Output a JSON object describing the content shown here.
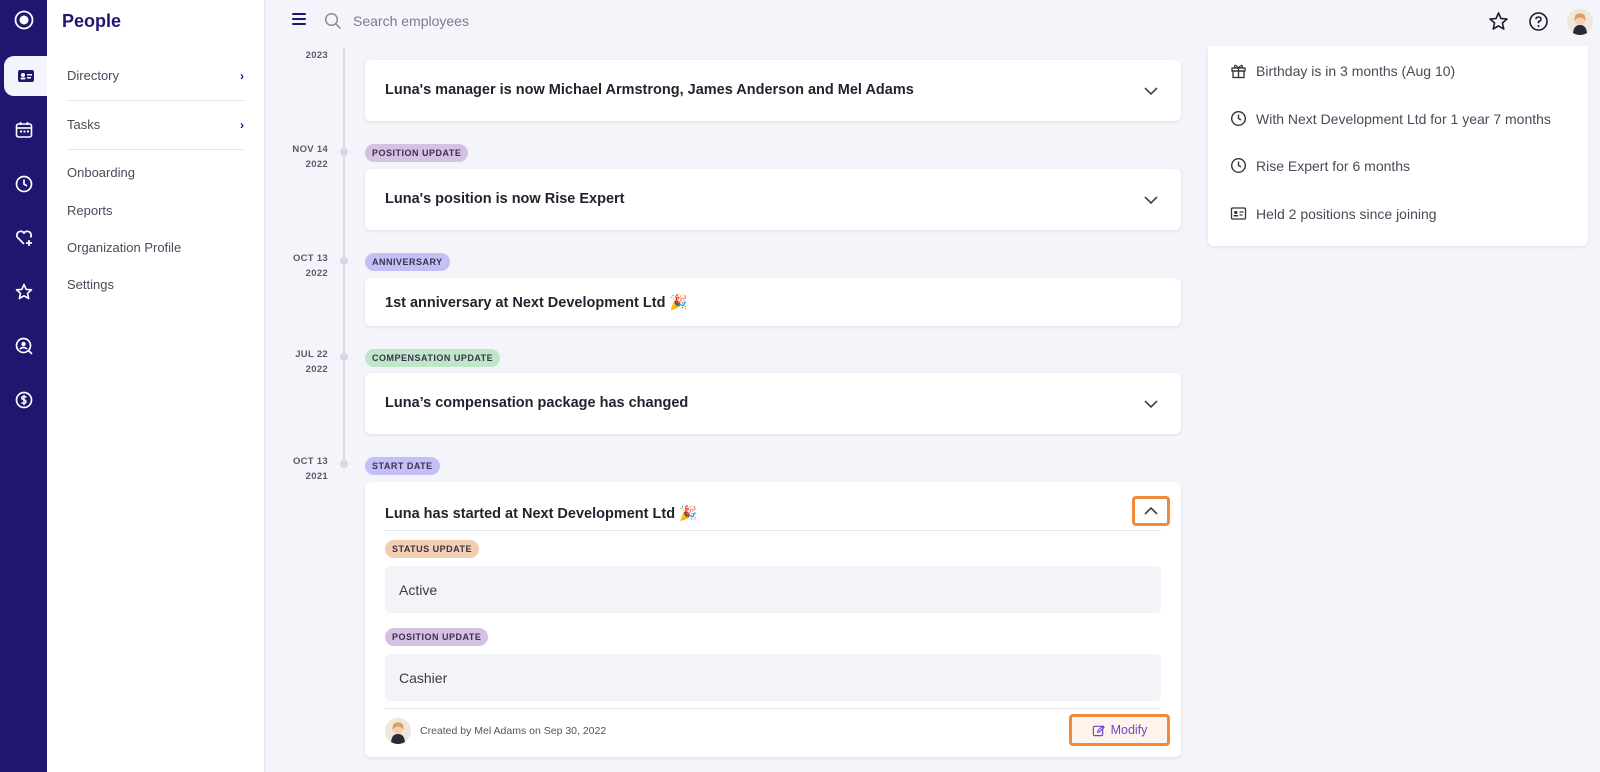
{
  "app": {
    "section_title": "People"
  },
  "sidenav": {
    "items": [
      {
        "label": "Directory",
        "has_submenu": true
      },
      {
        "label": "Tasks",
        "has_submenu": true
      },
      {
        "label": "Onboarding"
      },
      {
        "label": "Reports"
      },
      {
        "label": "Organization Profile"
      },
      {
        "label": "Settings"
      }
    ]
  },
  "rail": {
    "icons": [
      "logo-icon",
      "people-card-icon",
      "calendar-icon",
      "clock-icon",
      "heart-plus-icon",
      "star-person-icon",
      "search-person-icon",
      "dollar-icon"
    ],
    "active": "people-card-icon"
  },
  "search": {
    "placeholder": "Search employees"
  },
  "timeline": {
    "top_partial_date": "2023",
    "top_card_title": "Luna's manager is now Michael Armstrong, James Anderson and Mel Adams",
    "events": [
      {
        "date_month_day": "NOV 14",
        "date_year": "2022",
        "tag": "POSITION UPDATE",
        "title": "Luna's position is now Rise Expert"
      },
      {
        "date_month_day": "OCT 13",
        "date_year": "2022",
        "tag": "ANNIVERSARY",
        "title": "1st anniversary at Next Development Ltd",
        "emoji": "🎉"
      },
      {
        "date_month_day": "JUL 22",
        "date_year": "2022",
        "tag": "COMPENSATION UPDATE",
        "title": "Luna’s compensation package has changed"
      },
      {
        "date_month_day": "OCT 13",
        "date_year": "2021",
        "tag": "START DATE",
        "title": "Luna has started at Next Development Ltd",
        "emoji": "🎉",
        "details": [
          {
            "tag": "STATUS UPDATE",
            "value": "Active"
          },
          {
            "tag": "POSITION UPDATE",
            "value": "Cashier"
          }
        ],
        "created_by": "Created by Mel Adams on Sep 30, 2022",
        "modify_label": "Modify"
      }
    ]
  },
  "info": {
    "rows": [
      {
        "icon": "gift-icon",
        "text": "Birthday is in 3 months (Aug 10)"
      },
      {
        "icon": "clock-icon",
        "text": "With Next Development Ltd for 1 year 7 months"
      },
      {
        "icon": "clock-icon",
        "text": "Rise Expert for 6 months"
      },
      {
        "icon": "id-card-icon",
        "text": "Held 2 positions since joining"
      }
    ]
  },
  "colors": {
    "rail": "#1f1670",
    "highlight": "#f08a3a",
    "accent": "#6a48d0"
  }
}
